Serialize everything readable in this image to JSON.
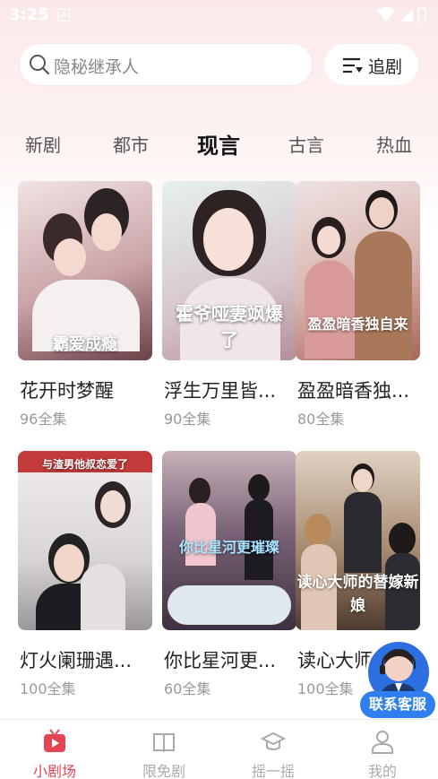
{
  "status_bar": {
    "time": "3:25",
    "notification_icon": "A"
  },
  "search": {
    "placeholder": "隐秘继承人"
  },
  "drama_button": {
    "label": "追剧"
  },
  "tabs": [
    {
      "label": "新剧"
    },
    {
      "label": "都市"
    },
    {
      "label": "现言",
      "active": true
    },
    {
      "label": "古言"
    },
    {
      "label": "热血"
    }
  ],
  "dramas": [
    {
      "title": "花开时梦醒",
      "count": "96全集",
      "poster_text": "霸爱成瘾",
      "palette": [
        "#e9d6d8",
        "#7a5058"
      ]
    },
    {
      "title": "浮生万里皆...",
      "count": "90全集",
      "poster_text": "霍爷哑妻飒爆了",
      "palette": [
        "#d9e9e6",
        "#c9a7b0"
      ]
    },
    {
      "title": "盈盈暗香独...",
      "count": "80全集",
      "poster_text": "盈盈暗香独自来",
      "palette": [
        "#e8d6d6",
        "#b06a62"
      ]
    },
    {
      "title": "灯火阑珊遇...",
      "count": "100全集",
      "poster_text": "与渣男他叔恋爱了",
      "palette": [
        "#e6e2e2",
        "#5a5a62"
      ]
    },
    {
      "title": "你比星河更...",
      "count": "60全集",
      "poster_text": "你比星河更璀璨",
      "palette": [
        "#c9c3d8",
        "#4e3a52"
      ]
    },
    {
      "title": "读心大师...",
      "count": "100全集",
      "poster_text": "读心大师的替嫁新娘",
      "palette": [
        "#d8c8b8",
        "#6a4a3a"
      ]
    }
  ],
  "customer_service": {
    "label": "联系客服"
  },
  "bottom_nav": [
    {
      "label": "小剧场",
      "icon": "tv-icon",
      "active": true
    },
    {
      "label": "限免剧",
      "icon": "book-icon"
    },
    {
      "label": "摇一摇",
      "icon": "graduation-cap-icon"
    },
    {
      "label": "我的",
      "icon": "user-icon"
    }
  ],
  "colors": {
    "accent": "#e54454",
    "service_blue": "#2f7ff0"
  }
}
